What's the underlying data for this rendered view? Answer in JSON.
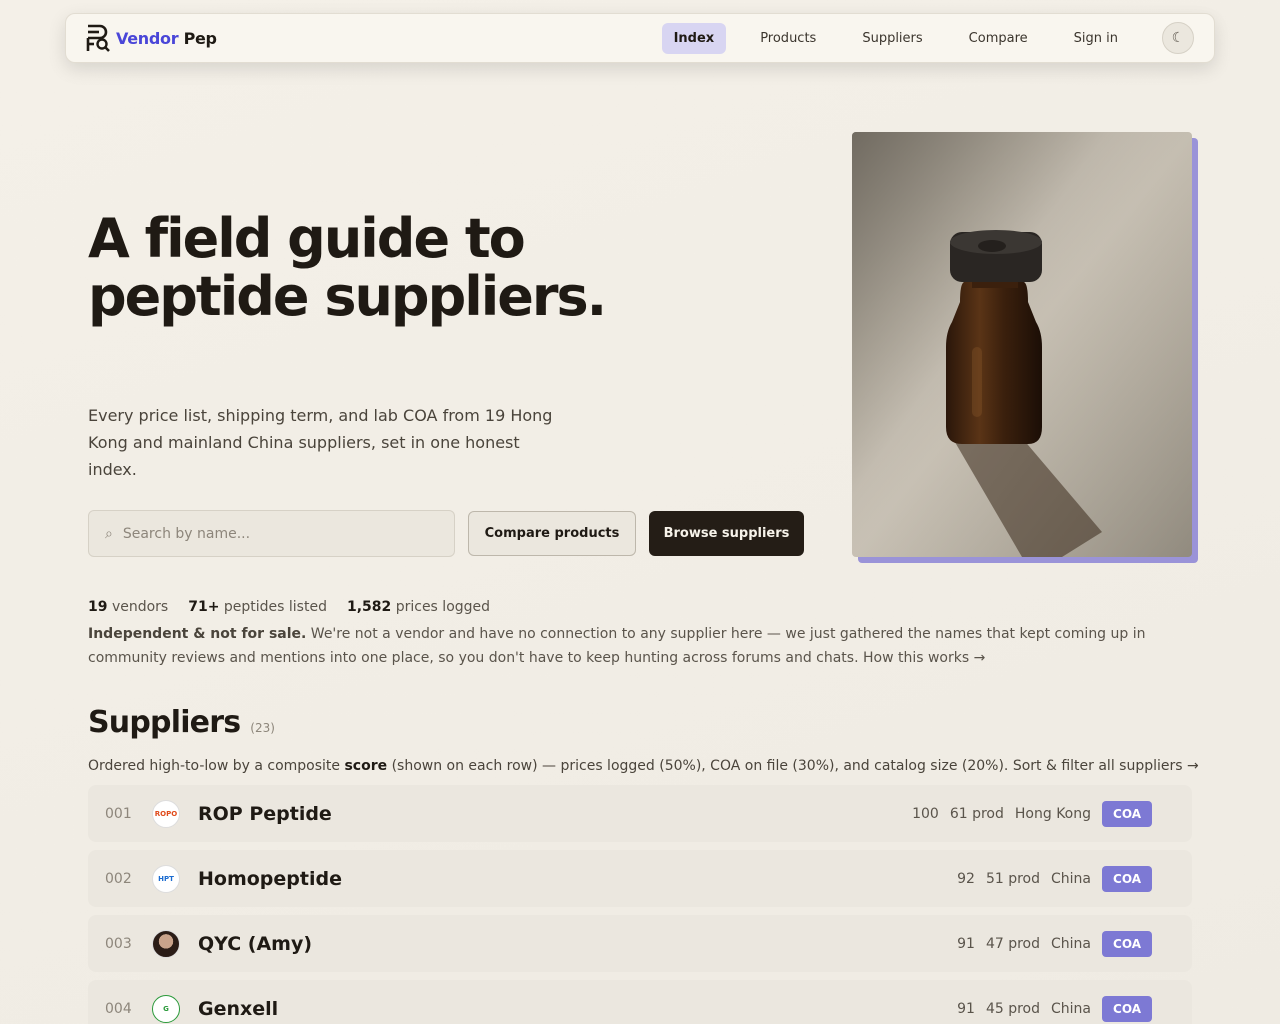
{
  "nav": {
    "logo_vendor": "Vendor",
    "logo_pep": "Pep",
    "links": [
      "Index",
      "Products",
      "Suppliers",
      "Compare",
      "Sign in"
    ],
    "theme_icon": "☾"
  },
  "hero": {
    "title": "A field guide to peptide suppliers.",
    "subtitle": "Every price list, shipping term, and lab COA from 19 Hong Kong and mainland China suppliers, set in one honest index.",
    "search_placeholder": "Search by name...",
    "search_icon": "⌕",
    "compare_label": "Compare products",
    "browse_label": "Browse suppliers"
  },
  "stats": {
    "vendors_num": "19",
    "vendors_label": "vendors",
    "peptides_num": "71+",
    "peptides_label": "peptides listed",
    "prices_num": "1,582",
    "prices_label": "prices logged"
  },
  "disclaimer": {
    "bold": "Independent & not for sale.",
    "text": " We're not a vendor and have no connection to any supplier here — we just gathered the names that kept coming up in community reviews and mentions into one place, so you don't have to keep hunting across forums and chats. How this works →"
  },
  "suppliers": {
    "title": "Suppliers",
    "count": "(23)",
    "desc_pre": "Ordered high-to-low by a composite ",
    "desc_bold": "score",
    "desc_post": " (shown on each row) — prices logged (50%), COA on file (30%), and catalog size (20%). Sort & filter all suppliers →",
    "rows": [
      {
        "num": "001",
        "name": "ROP Peptide",
        "score": "100",
        "prod": "61 prod",
        "region": "Hong Kong",
        "badge": "COA",
        "logo_text": "ROPO"
      },
      {
        "num": "002",
        "name": "Homopeptide",
        "score": "92",
        "prod": "51 prod",
        "region": "China",
        "badge": "COA",
        "logo_text": "HPT"
      },
      {
        "num": "003",
        "name": "QYC (Amy)",
        "score": "91",
        "prod": "47 prod",
        "region": "China",
        "badge": "COA",
        "logo_text": ""
      },
      {
        "num": "004",
        "name": "Genxell",
        "score": "91",
        "prod": "45 prod",
        "region": "China",
        "badge": "COA",
        "logo_text": "G"
      }
    ]
  },
  "colors": {
    "accent": "#4a46d8",
    "badge": "#7d79d4",
    "active_tab": "#d8d5f2",
    "dark_button": "#241d16"
  }
}
